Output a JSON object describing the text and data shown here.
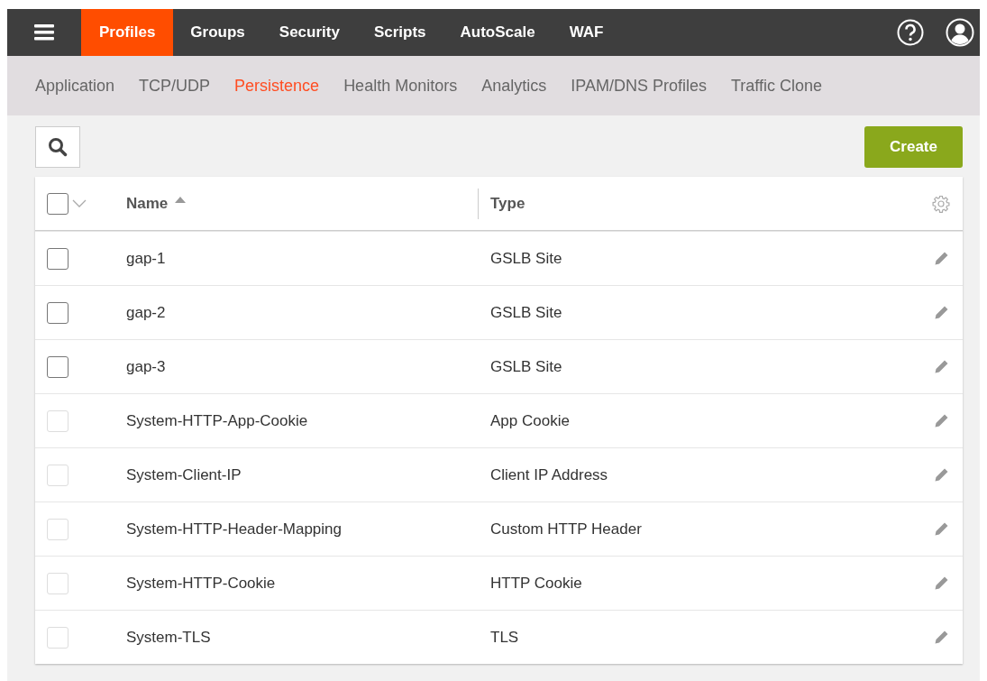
{
  "top_nav": {
    "items": [
      {
        "label": "Profiles",
        "selected": true
      },
      {
        "label": "Groups",
        "selected": false
      },
      {
        "label": "Security",
        "selected": false
      },
      {
        "label": "Scripts",
        "selected": false
      },
      {
        "label": "AutoScale",
        "selected": false
      },
      {
        "label": "WAF",
        "selected": false
      }
    ]
  },
  "sub_nav": {
    "items": [
      {
        "label": "Application",
        "selected": false
      },
      {
        "label": "TCP/UDP",
        "selected": false
      },
      {
        "label": "Persistence",
        "selected": true
      },
      {
        "label": "Health Monitors",
        "selected": false
      },
      {
        "label": "Analytics",
        "selected": false
      },
      {
        "label": "IPAM/DNS Profiles",
        "selected": false
      },
      {
        "label": "Traffic Clone",
        "selected": false
      }
    ]
  },
  "toolbar": {
    "create_button": "Create"
  },
  "table": {
    "columns": [
      "Name",
      "Type"
    ],
    "select_all": {
      "checked": false
    },
    "rows": [
      {
        "name": "gap-1",
        "type": "GSLB Site",
        "checked": false,
        "disabled": false
      },
      {
        "name": "gap-2",
        "type": "GSLB Site",
        "checked": false,
        "disabled": false
      },
      {
        "name": "gap-3",
        "type": "GSLB Site",
        "checked": false,
        "disabled": false
      },
      {
        "name": "System-HTTP-App-Cookie",
        "type": "App Cookie",
        "checked": false,
        "disabled": true
      },
      {
        "name": "System-Client-IP",
        "type": "Client IP Address",
        "checked": false,
        "disabled": true
      },
      {
        "name": "System-HTTP-Header-Mapping",
        "type": "Custom HTTP Header",
        "checked": false,
        "disabled": true
      },
      {
        "name": "System-HTTP-Cookie",
        "type": "HTTP Cookie",
        "checked": false,
        "disabled": true
      },
      {
        "name": "System-TLS",
        "type": "TLS",
        "checked": false,
        "disabled": true
      }
    ]
  }
}
